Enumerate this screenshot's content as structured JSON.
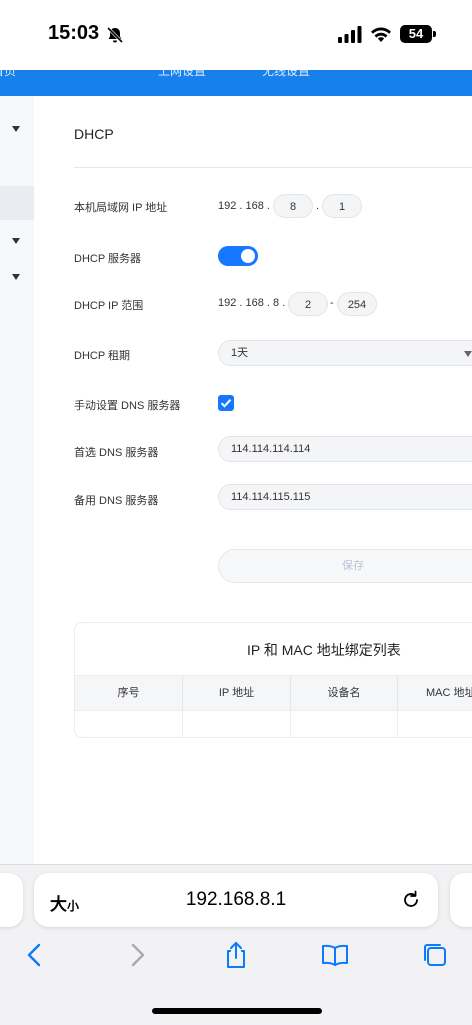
{
  "status": {
    "time": "15:03",
    "battery": "54"
  },
  "topnav": {
    "items": [
      "首页",
      "上网设置",
      "无线设置"
    ]
  },
  "dhcp": {
    "section_title": "DHCP",
    "lan_ip_label": "本机局域网 IP 地址",
    "lan_ip_prefix": "192 . 168 .",
    "lan_ip_octet3": "8",
    "lan_ip_dot": ".",
    "lan_ip_octet4": "1",
    "server_label": "DHCP 服务器",
    "server_enabled": true,
    "range_label": "DHCP IP 范围",
    "range_prefix": "192 . 168 . 8 .",
    "range_start": "2",
    "range_dash": "-",
    "range_end": "254",
    "lease_label": "DHCP 租期",
    "lease_value": "1天",
    "manual_dns_label": "手动设置 DNS 服务器",
    "manual_dns_checked": true,
    "primary_dns_label": "首选 DNS 服务器",
    "primary_dns_value": "114.114.114.114",
    "secondary_dns_label": "备用 DNS 服务器",
    "secondary_dns_value": "114.114.115.115",
    "save_label": "保存"
  },
  "bind_table": {
    "title": "IP 和 MAC 地址绑定列表",
    "columns": [
      "序号",
      "IP 地址",
      "设备名",
      "MAC 地址"
    ]
  },
  "browser": {
    "text_size_label": "大",
    "text_size_small": "小",
    "url": "192.168.8.1"
  },
  "colors": {
    "accent": "#1677ff",
    "nav_blue": "#1780ea"
  }
}
